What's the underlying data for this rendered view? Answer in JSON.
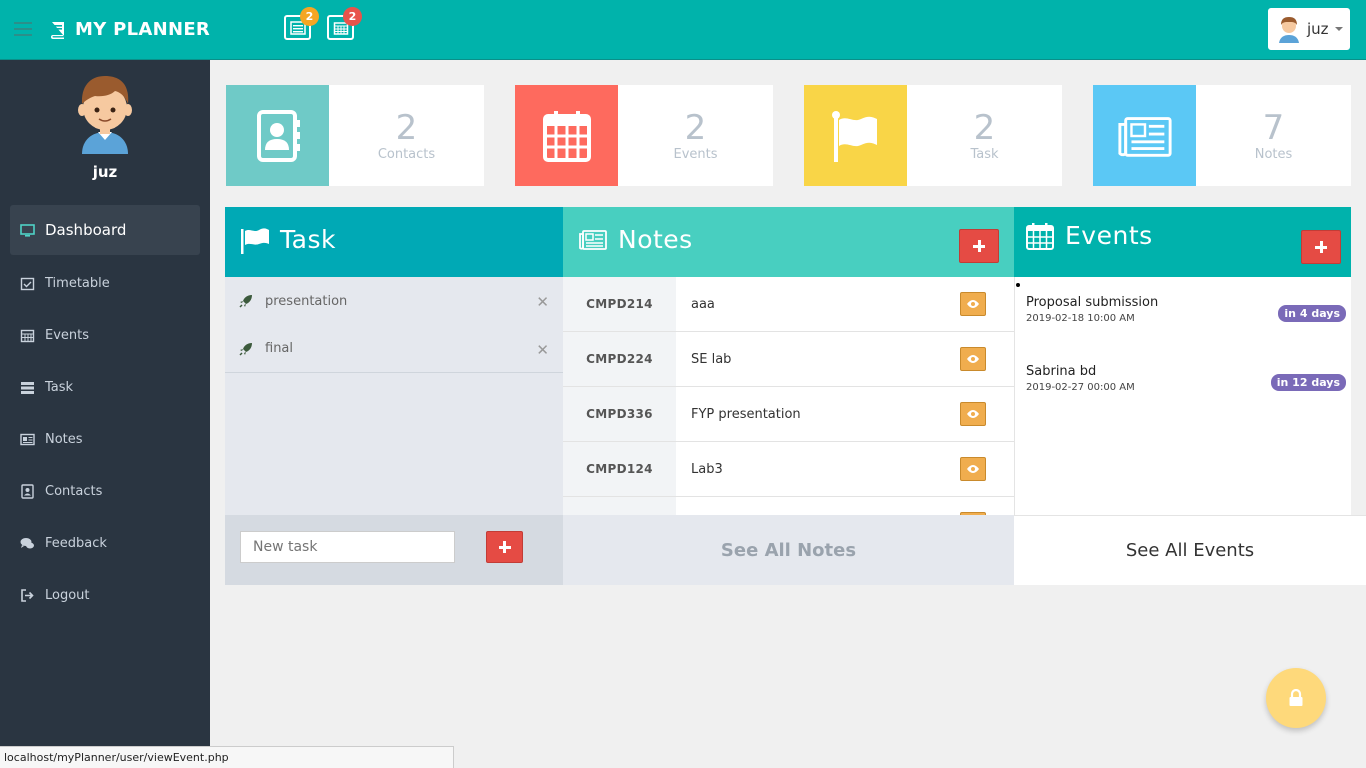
{
  "header": {
    "brand": "MY PLANNER",
    "notes_badge": "2",
    "events_badge": "2",
    "user": "juz"
  },
  "sidebar": {
    "username": "juz",
    "items": [
      {
        "label": "Dashboard",
        "icon": "monitor-icon",
        "active": true
      },
      {
        "label": "Timetable",
        "icon": "calendar-check-icon"
      },
      {
        "label": "Events",
        "icon": "calendar-icon"
      },
      {
        "label": "Task",
        "icon": "tasks-icon"
      },
      {
        "label": "Notes",
        "icon": "newspaper-icon"
      },
      {
        "label": "Contacts",
        "icon": "address-book-icon"
      },
      {
        "label": "Feedback",
        "icon": "comments-icon"
      },
      {
        "label": "Logout",
        "icon": "sign-out-icon"
      }
    ]
  },
  "stats": [
    {
      "value": "2",
      "label": "Contacts",
      "color": "#6fcac7"
    },
    {
      "value": "2",
      "label": "Events",
      "color": "#fe6a5e"
    },
    {
      "value": "2",
      "label": "Task",
      "color": "#f9d547"
    },
    {
      "value": "7",
      "label": "Notes",
      "color": "#5bc8f5"
    }
  ],
  "task_panel": {
    "title": "Task",
    "items": [
      "presentation",
      "final"
    ],
    "new_task_placeholder": "New task"
  },
  "notes_panel": {
    "title": "Notes",
    "rows": [
      {
        "code": "CMPD214",
        "title": "aaa"
      },
      {
        "code": "CMPD224",
        "title": "SE lab"
      },
      {
        "code": "CMPD336",
        "title": "FYP presentation"
      },
      {
        "code": "CMPD124",
        "title": "Lab3"
      }
    ],
    "see_all": "See All Notes"
  },
  "events_panel": {
    "title": "Events",
    "events": [
      {
        "name": "Proposal submission",
        "date": "2019-02-18 10:00 AM",
        "due": "in 4 days"
      },
      {
        "name": "Sabrina bd",
        "date": "2019-02-27 00:00 AM",
        "due": "in 12 days"
      }
    ],
    "see_all": "See All Events"
  },
  "statusbar": "localhost/myPlanner/user/viewEvent.php",
  "colors": {
    "header": "#00b3ab",
    "sidebar": "#2a3541",
    "task_header": "#00a9b5",
    "notes_header": "#48cfc0",
    "events_header": "#00b2ac",
    "danger": "#e54b44",
    "warning": "#f0ad4e"
  }
}
